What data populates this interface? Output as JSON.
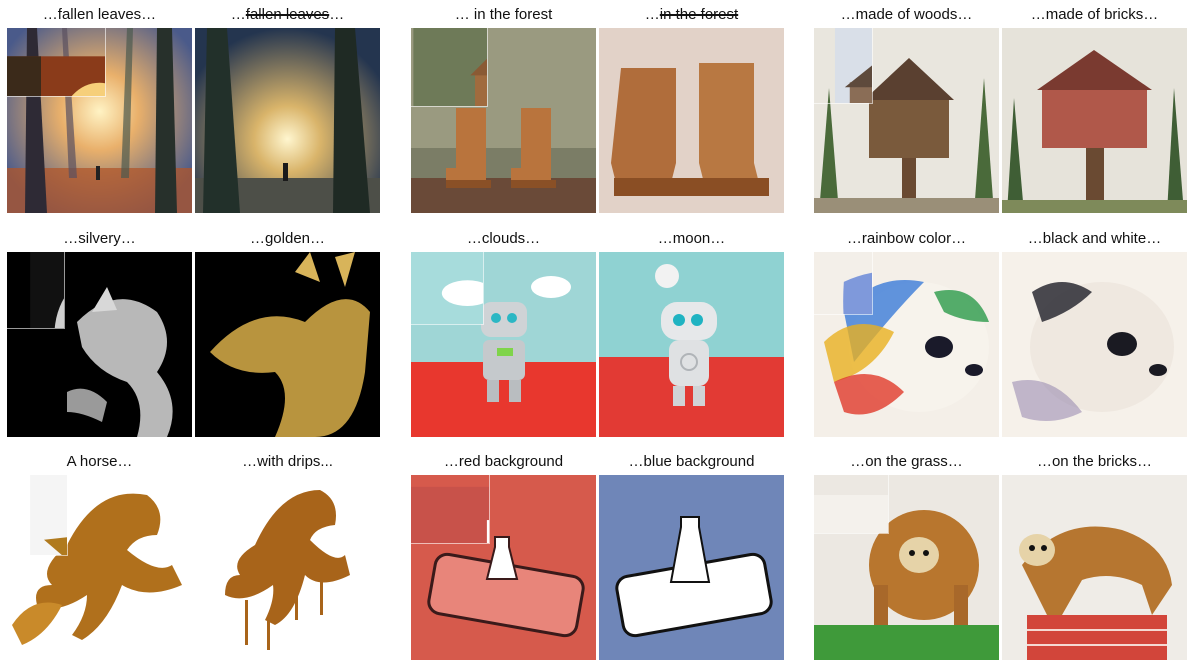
{
  "panels": [
    {
      "caption_prefix": "…",
      "caption_strike": "",
      "caption_main": "fallen leaves…",
      "subject": "misty forest path"
    },
    {
      "caption_prefix": "…",
      "caption_strike": "fallen leaves",
      "caption_main": "…",
      "subject": "misty forest path without leaves"
    },
    {
      "caption_prefix": "… ",
      "caption_strike": "",
      "caption_main": "in the forest",
      "subject": "wooden boots in forest"
    },
    {
      "caption_prefix": "…",
      "caption_strike": "in the forest",
      "caption_main": "",
      "subject": "wooden boots studio"
    },
    {
      "caption_prefix": "…",
      "caption_strike": "",
      "caption_main": "made of woods…",
      "subject": "wooden treehouse"
    },
    {
      "caption_prefix": "…",
      "caption_strike": "",
      "caption_main": "made of bricks…",
      "subject": "brick treehouse"
    },
    {
      "caption_prefix": "…",
      "caption_strike": "",
      "caption_main": "silvery…",
      "subject": "silver dragon"
    },
    {
      "caption_prefix": "…",
      "caption_strike": "",
      "caption_main": "golden…",
      "subject": "golden dragon"
    },
    {
      "caption_prefix": "…",
      "caption_strike": "",
      "caption_main": "clouds…",
      "subject": "robot with clouds"
    },
    {
      "caption_prefix": "…",
      "caption_strike": "",
      "caption_main": "moon…",
      "subject": "robot with moon"
    },
    {
      "caption_prefix": "…",
      "caption_strike": "",
      "caption_main": "rainbow color…",
      "subject": "rainbow panda"
    },
    {
      "caption_prefix": "…",
      "caption_strike": "",
      "caption_main": "black and white…",
      "subject": "black and white panda"
    },
    {
      "caption_prefix": "",
      "caption_strike": "",
      "caption_main": "A horse…",
      "subject": "golden horse"
    },
    {
      "caption_prefix": "…",
      "caption_strike": "",
      "caption_main": "with drips...",
      "subject": "golden horse with drips"
    },
    {
      "caption_prefix": "…",
      "caption_strike": "",
      "caption_main": "red background",
      "subject": "phone vase red"
    },
    {
      "caption_prefix": "…",
      "caption_strike": "",
      "caption_main": "blue background",
      "subject": "phone vase blue"
    },
    {
      "caption_prefix": "…",
      "caption_strike": "",
      "caption_main": "on the grass…",
      "subject": "sloth on grass"
    },
    {
      "caption_prefix": "…",
      "caption_strike": "",
      "caption_main": "on the bricks…",
      "subject": "sloth on bricks"
    }
  ],
  "colors": {
    "background": "#ffffff",
    "caption_text": "#111111"
  }
}
